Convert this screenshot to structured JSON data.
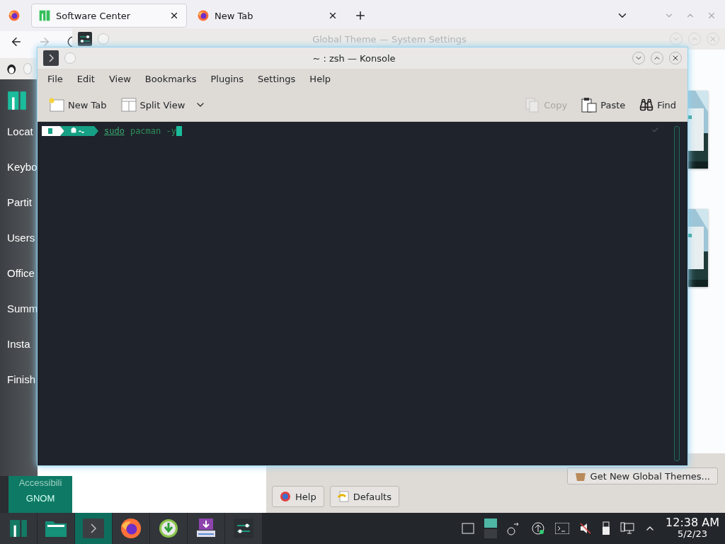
{
  "browser": {
    "tabs": [
      {
        "label": "Software Center",
        "selected": true,
        "kind": "manjaro"
      },
      {
        "label": "New Tab",
        "selected": false,
        "kind": "firefox"
      }
    ]
  },
  "settings_window": {
    "title": "Global Theme — System Settings",
    "get_new_button": "Get New Global Themes...",
    "help_button": "Help",
    "defaults_button": "Defaults"
  },
  "installer": {
    "steps": [
      "Locat",
      "Keybo",
      "Partit",
      "Users",
      "Office",
      "Summ",
      "Insta",
      "Finish"
    ]
  },
  "welcome_panel": {
    "lines": [
      "Accessibili",
      "GNOM"
    ]
  },
  "konsole": {
    "title": "~ : zsh — Konsole",
    "menu": [
      "File",
      "Edit",
      "View",
      "Bookmarks",
      "Plugins",
      "Settings",
      "Help"
    ],
    "toolbar": [
      {
        "label": "New Tab",
        "kind": "new-tab",
        "disabled": false
      },
      {
        "label": "Split View",
        "kind": "split-view",
        "disabled": false
      },
      {
        "label": "Copy",
        "kind": "copy",
        "disabled": true
      },
      {
        "label": "Paste",
        "kind": "paste",
        "disabled": false
      },
      {
        "label": "Find",
        "kind": "find",
        "disabled": false
      }
    ],
    "prompt": {
      "command": "sudo",
      "arguments": "pacman -y"
    }
  },
  "taskbar": {
    "apps": [
      {
        "kind": "manjaro",
        "selected": false
      },
      {
        "kind": "folder",
        "selected": false
      },
      {
        "kind": "terminal",
        "selected": true
      },
      {
        "kind": "firefox",
        "selected": false
      },
      {
        "kind": "download",
        "selected": false
      },
      {
        "kind": "installer",
        "selected": false
      },
      {
        "kind": "settings",
        "selected": false
      }
    ],
    "clock": {
      "time": "12:38 AM",
      "date": "5/2/23"
    }
  }
}
